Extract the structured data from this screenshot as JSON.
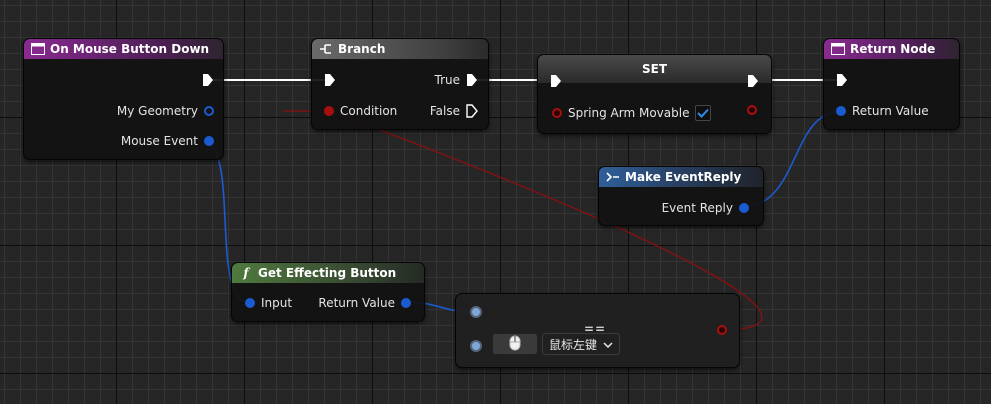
{
  "nodes": {
    "mouse_down": {
      "title": "On Mouse Button Down",
      "pins": {
        "geometry": "My Geometry",
        "event": "Mouse Event"
      }
    },
    "branch": {
      "title": "Branch",
      "pins": {
        "condition": "Condition",
        "true": "True",
        "false": "False"
      }
    },
    "set": {
      "title": "SET",
      "variable": "Spring Arm Movable",
      "checked": true
    },
    "return_node": {
      "title": "Return Node",
      "pins": {
        "return_value": "Return Value"
      }
    },
    "make_reply": {
      "title": "Make EventReply",
      "pins": {
        "event_reply": "Event Reply"
      }
    },
    "get_button": {
      "title": "Get Effecting Button",
      "pins": {
        "input": "Input",
        "return_value": "Return Value"
      }
    },
    "equal": {
      "title": "==",
      "key_value": "鼠标左键"
    }
  },
  "colors": {
    "exec": "#ffffff",
    "struct": "#1a5bd1",
    "bool": "#a80f0f",
    "event_header": "#8a2a92",
    "function_header": "#4f7a3e",
    "pure_header": "#2f5f9a"
  },
  "icons": {
    "event": "event-icon",
    "branch": "branch-icon",
    "function": "function-icon",
    "make": "make-struct-icon",
    "mouse": "mouse-icon",
    "dropdown": "chevron-down-icon"
  }
}
